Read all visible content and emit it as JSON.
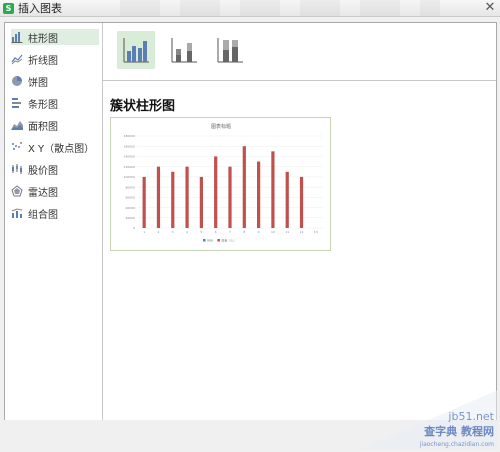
{
  "window": {
    "title": "插入图表",
    "close_glyph": "✕",
    "app_icon_letter": "S"
  },
  "sidebar": {
    "items": [
      {
        "label": "柱形图",
        "icon": "column-chart-icon",
        "selected": true
      },
      {
        "label": "折线图",
        "icon": "line-chart-icon"
      },
      {
        "label": "饼图",
        "icon": "pie-chart-icon"
      },
      {
        "label": "条形图",
        "icon": "bar-chart-icon"
      },
      {
        "label": "面积图",
        "icon": "area-chart-icon"
      },
      {
        "label": "X Y（散点图）",
        "icon": "scatter-chart-icon"
      },
      {
        "label": "股价图",
        "icon": "stock-chart-icon"
      },
      {
        "label": "雷达图",
        "icon": "radar-chart-icon"
      },
      {
        "label": "组合图",
        "icon": "combo-chart-icon"
      }
    ]
  },
  "subtypes": [
    {
      "name": "clustered-column",
      "selected": true
    },
    {
      "name": "stacked-column"
    },
    {
      "name": "percent-stacked-column"
    }
  ],
  "main": {
    "section_title": "簇状柱形图"
  },
  "preview": {
    "chart_data": {
      "type": "bar",
      "title": "图表标题",
      "categories": [
        "1",
        "2",
        "3",
        "4",
        "5",
        "6",
        "7",
        "8",
        "9",
        "10",
        "11",
        "12",
        "13"
      ],
      "series": [
        {
          "values": [
            0,
            0,
            0,
            0,
            0,
            0,
            0,
            0,
            0,
            0,
            0,
            0,
            0
          ]
        },
        {
          "values": [
            100000,
            120000,
            110000,
            120000,
            100000,
            140000,
            120000,
            160000,
            130000,
            150000,
            110000,
            100000,
            0
          ]
        }
      ],
      "ylim": [
        0,
        180000
      ],
      "y_ticks": [
        "180000",
        "160000",
        "140000",
        "120000",
        "100000",
        "80000",
        "60000",
        "40000",
        "20000",
        "0"
      ],
      "legend_placement": "bottom",
      "legend_items": [
        "月份",
        "数量（人）"
      ],
      "series_colors": [
        "#4f81bd",
        "#c0504d"
      ]
    }
  },
  "colors": {
    "accent_green": "#2fa84f",
    "selected_bg": "#dfeee0",
    "icon_blue": "#5b7fb5"
  },
  "watermark": {
    "line1": "jb51.net",
    "line2": "查字典 教程网",
    "line3": "jiaocheng.chazidian.com"
  }
}
